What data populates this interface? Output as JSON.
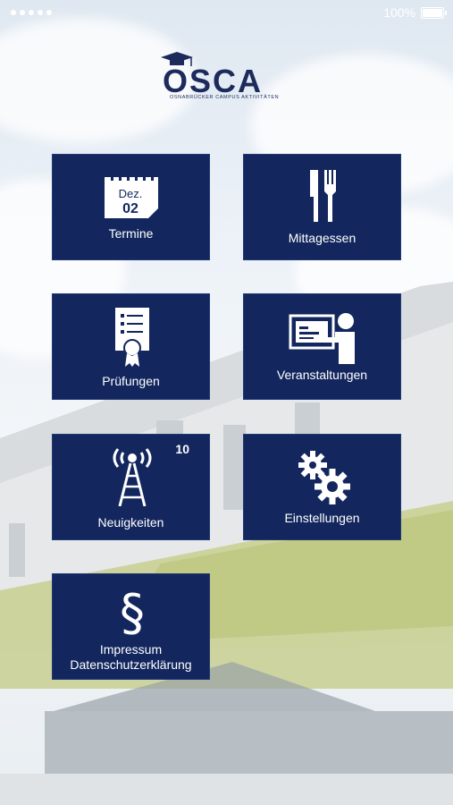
{
  "status_bar": {
    "battery_text": "100%"
  },
  "logo": {
    "title": "OSCA",
    "subtitle": "OSNABRÜCKER CAMPUS AKTIVITÄTEN"
  },
  "tiles": {
    "termine": {
      "label": "Termine",
      "calendar_month": "Dez.",
      "calendar_day": "02"
    },
    "mittagessen": {
      "label": "Mittagessen"
    },
    "pruefungen": {
      "label": "Prüfungen"
    },
    "veranstaltungen": {
      "label": "Veranstaltungen"
    },
    "neuigkeiten": {
      "label": "Neuigkeiten",
      "badge": "10"
    },
    "einstellungen": {
      "label": "Einstellungen"
    },
    "impressum": {
      "label_line1": "Impressum",
      "label_line2": "Datenschutzerklärung"
    }
  },
  "colors": {
    "tile": "#13275e",
    "logo": "#1c2a5c"
  }
}
